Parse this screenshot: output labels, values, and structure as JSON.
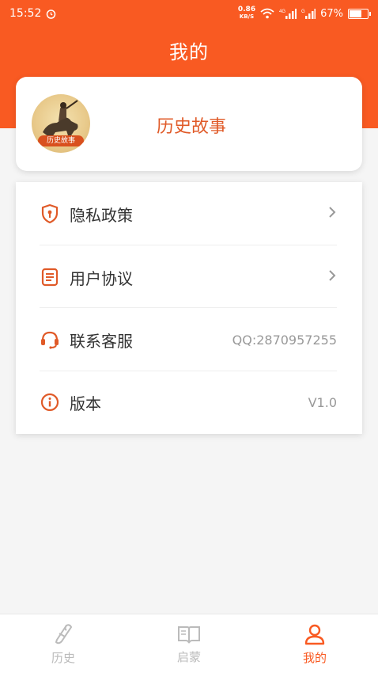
{
  "status_bar": {
    "time": "15:52",
    "net_speed_value": "0.86",
    "net_speed_unit": "KB/S",
    "battery": "67%"
  },
  "header": {
    "title": "我的"
  },
  "profile": {
    "avatar_text": "历史故事",
    "name": "历史故事"
  },
  "menu": {
    "items": [
      {
        "label": "隐私政策",
        "value": "",
        "icon": "shield-icon"
      },
      {
        "label": "用户协议",
        "value": "",
        "icon": "document-icon"
      },
      {
        "label": "联系客服",
        "value": "QQ:2870957255",
        "icon": "headset-icon"
      },
      {
        "label": "版本",
        "value": "V1.0",
        "icon": "info-icon"
      }
    ]
  },
  "tabbar": {
    "tabs": [
      {
        "label": "历史",
        "icon": "scroll-icon",
        "active": false
      },
      {
        "label": "启蒙",
        "icon": "book-icon",
        "active": false
      },
      {
        "label": "我的",
        "icon": "person-icon",
        "active": true
      }
    ]
  },
  "colors": {
    "accent": "#f95a22",
    "icon": "#e05a28",
    "inactive": "#bbbbbb"
  }
}
